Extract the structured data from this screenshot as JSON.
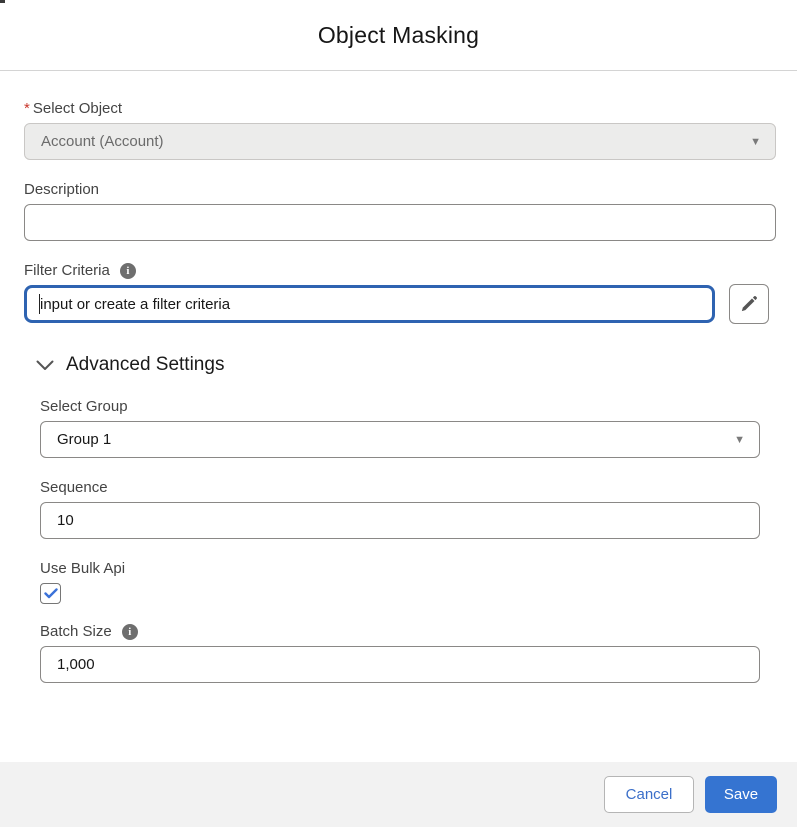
{
  "header": {
    "title": "Object Masking"
  },
  "form": {
    "select_object": {
      "label": "Select Object",
      "required_marker": "*",
      "value": "Account (Account)",
      "disabled": true
    },
    "description": {
      "label": "Description",
      "value": ""
    },
    "filter_criteria": {
      "label": "Filter Criteria",
      "value": "input or create a filter criteria"
    },
    "advanced": {
      "title": "Advanced Settings",
      "select_group": {
        "label": "Select Group",
        "value": "Group 1"
      },
      "sequence": {
        "label": "Sequence",
        "value": "10"
      },
      "use_bulk_api": {
        "label": "Use Bulk Api",
        "checked": true
      },
      "batch_size": {
        "label": "Batch Size",
        "value": "1,000"
      }
    }
  },
  "footer": {
    "cancel_label": "Cancel",
    "save_label": "Save"
  },
  "icons": {
    "info": "i",
    "dropdown_caret": "▼"
  },
  "colors": {
    "accent_blue": "#3574d1",
    "focus_border": "#2e63b1",
    "required_red": "#c9372c",
    "footer_bg": "#f2f2f2",
    "disabled_bg": "#ececeb"
  }
}
